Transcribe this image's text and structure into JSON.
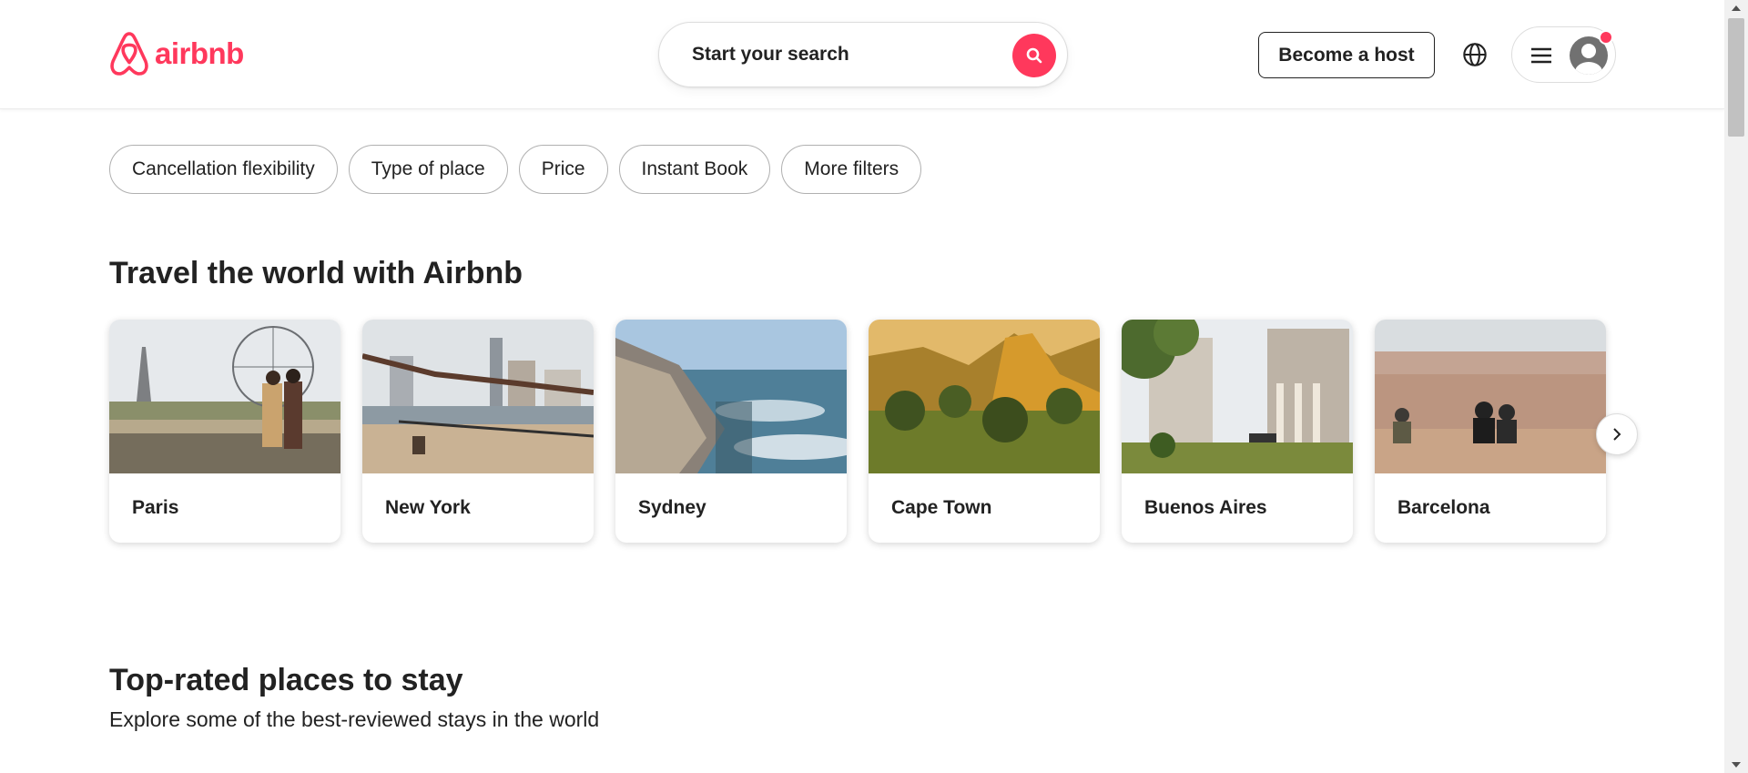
{
  "brand": {
    "name": "airbnb",
    "accent_color": "#FF385C"
  },
  "header": {
    "search_placeholder": "Start your search",
    "become_host_label": "Become a host",
    "language_icon": "globe-icon",
    "menu_icon": "hamburger-icon",
    "avatar_icon": "user-avatar-icon",
    "has_notification": true
  },
  "filters": [
    {
      "label": "Cancellation flexibility"
    },
    {
      "label": "Type of place"
    },
    {
      "label": "Price"
    },
    {
      "label": "Instant Book"
    },
    {
      "label": "More filters"
    }
  ],
  "travel_section": {
    "title": "Travel the world with Airbnb",
    "cities": [
      {
        "name": "Paris"
      },
      {
        "name": "New York"
      },
      {
        "name": "Sydney"
      },
      {
        "name": "Cape Town"
      },
      {
        "name": "Buenos Aires"
      },
      {
        "name": "Barcelona"
      }
    ],
    "next_icon": "chevron-right-icon"
  },
  "top_rated_section": {
    "title": "Top-rated places to stay",
    "subtitle": "Explore some of the best-reviewed stays in the world"
  }
}
